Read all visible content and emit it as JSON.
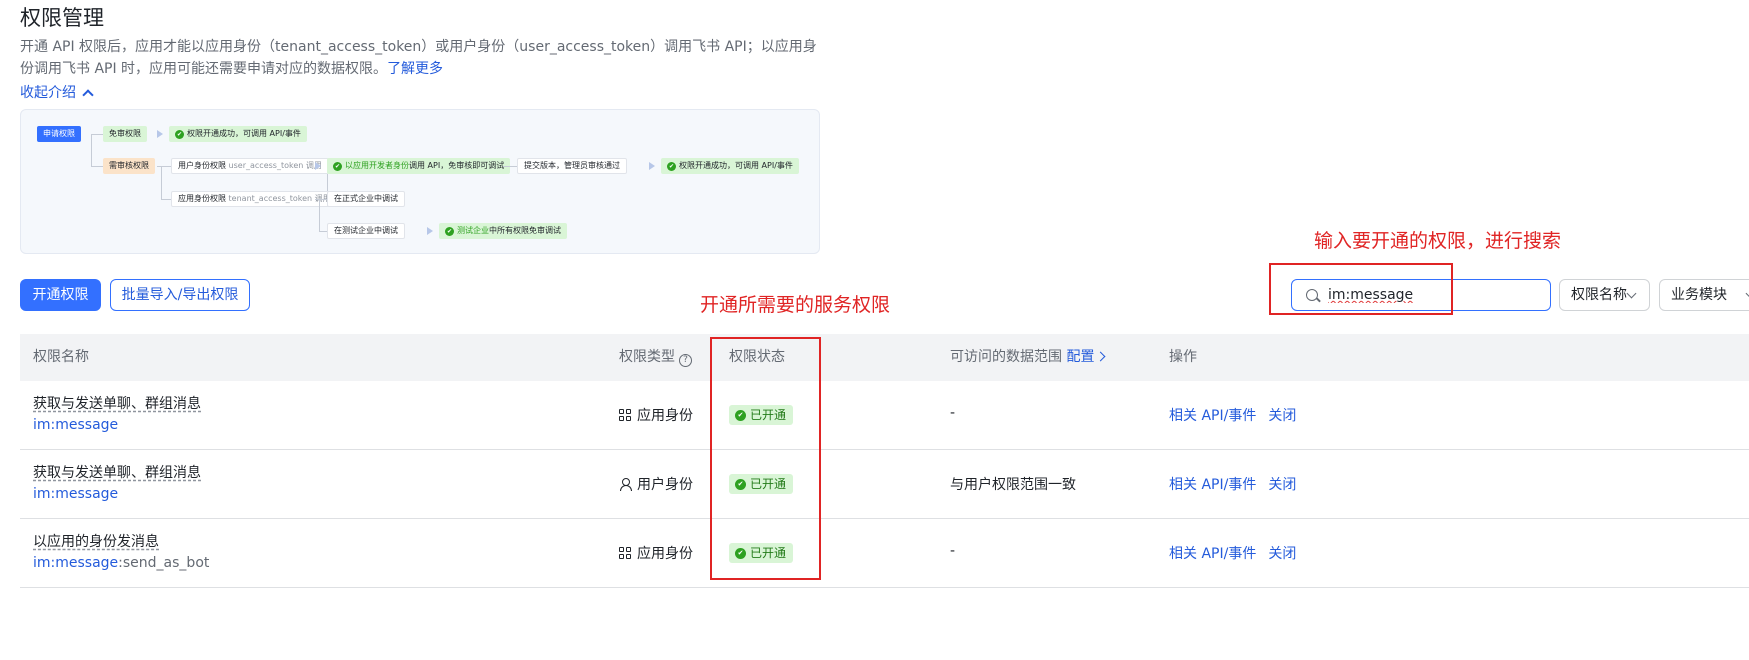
{
  "page": {
    "title": "权限管理",
    "intro_text": "开通 API 权限后，应用才能以应用身份（tenant_access_token）或用户身份（user_access_token）调用飞书 API；以应用身份调用飞书 API 时，应用可能还需要申请对应的数据权限。",
    "learn_more": "了解更多",
    "collapse_label": "收起介绍"
  },
  "flow": {
    "apply": "申请权限",
    "free": "免审权限",
    "free_result": "权限开通成功，可调用 API/事件",
    "review": "需审核权限",
    "user_identity": "用户身份权限",
    "user_identity_token": "user_access_token 调用",
    "dev_identity_accent": "以应用开发者身份",
    "dev_identity_rest": "调用 API，免审核即可调试",
    "submit": "提交版本，管理员审核通过",
    "review_result": "权限开通成功，可调用 API/事件",
    "app_identity": "应用身份权限",
    "app_identity_token": "tenant_access_token 调用",
    "prod_debug": "在正式企业中调试",
    "test_debug": "在测试企业中调试",
    "test_result_accent": "测试企业",
    "test_result_rest": "中所有权限免审调试"
  },
  "toolbar": {
    "enable_button": "开通权限",
    "batch_button": "批量导入/导出权限",
    "search_value": "im:message",
    "select_name": "权限名称",
    "select_module": "业务模块"
  },
  "table": {
    "headers": {
      "name": "权限名称",
      "type": "权限类型",
      "status": "权限状态",
      "scope": "可访问的数据范围",
      "config": "配置",
      "actions": "操作"
    },
    "rows": [
      {
        "name": "获取与发送单聊、群组消息",
        "code_kw": "im:message",
        "code_rest": "",
        "type": "应用身份",
        "type_icon": "grid-icon",
        "status": "已开通",
        "scope": "-",
        "action_api": "相关 API/事件",
        "action_close": "关闭"
      },
      {
        "name": "获取与发送单聊、群组消息",
        "code_kw": "im:message",
        "code_rest": "",
        "type": "用户身份",
        "type_icon": "user-icon",
        "status": "已开通",
        "scope": "与用户权限范围一致",
        "action_api": "相关 API/事件",
        "action_close": "关闭"
      },
      {
        "name": "以应用的身份发消息",
        "code_kw": "im:message",
        "code_rest": ":send_as_bot",
        "type": "应用身份",
        "type_icon": "grid-icon",
        "status": "已开通",
        "scope": "-",
        "action_api": "相关 API/事件",
        "action_close": "关闭"
      }
    ]
  },
  "annotations": {
    "search_hint": "输入要开通的权限，进行搜索",
    "status_hint": "开通所需要的服务权限"
  },
  "colors": {
    "primary": "#3370ff",
    "link": "#245bdb",
    "success_bg": "#d9f5d6",
    "success": "#2ea121",
    "annotation": "#e02424"
  }
}
